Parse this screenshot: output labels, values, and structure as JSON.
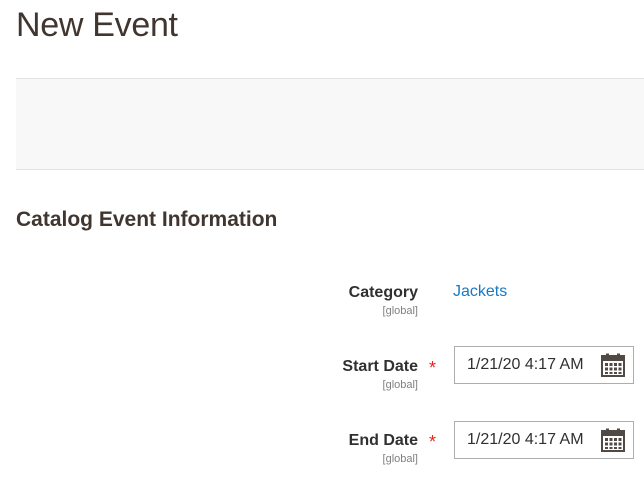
{
  "page": {
    "title": "New Event"
  },
  "section": {
    "title": "Catalog Event Information"
  },
  "fields": {
    "category": {
      "label": "Category",
      "scope": "[global]",
      "value": "Jackets"
    },
    "start_date": {
      "label": "Start Date",
      "scope": "[global]",
      "value": "1/21/20 4:17 AM",
      "required_mark": "*",
      "icon": "calendar-icon"
    },
    "end_date": {
      "label": "End Date",
      "scope": "[global]",
      "value": "1/21/20 4:17 AM",
      "required_mark": "*",
      "icon": "calendar-icon"
    }
  },
  "colors": {
    "title": "#41362f",
    "link": "#1979c3",
    "required": "#e22626",
    "action_bar_bg": "#f8f8f8"
  }
}
